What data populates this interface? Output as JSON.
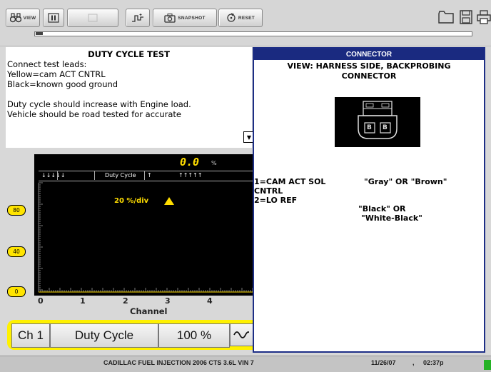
{
  "toolbar": {
    "view_label": "VIEW",
    "snapshot_label": "SNAPSHOT",
    "reset_label": "RESET"
  },
  "test_panel": {
    "title": "DUTY CYCLE TEST",
    "lines": [
      "Connect test leads:",
      "Yellow=cam ACT CNTRL",
      "Black=known good ground",
      "",
      "Duty cycle should increase with Engine load.",
      "Vehicle should be road tested for accurate"
    ]
  },
  "graph": {
    "readout": "0.0",
    "readout_unit": "%",
    "header_left_arrows": "↓↓↓↓↓",
    "header_label": "Duty Cycle",
    "header_mid_arrow": "↑",
    "header_right_arrows": "↑↑↑↑↑",
    "scale_label": "20 %/div",
    "y_labels": [
      "80",
      "40",
      "0"
    ],
    "x_ticks": [
      "0",
      "1",
      "2",
      "3",
      "4"
    ],
    "x_axis_label": "Channel",
    "marker_color": "#ffdd00",
    "trace_level_percent": 0
  },
  "controls": {
    "channel": "Ch 1",
    "measurement": "Duty Cycle",
    "scale": "100 %",
    "waveform_icon": "sine-wave-icon"
  },
  "connector": {
    "title": "CONNECTOR",
    "subtitle_line1": "VIEW: HARNESS SIDE, BACKPROBING",
    "subtitle_line2": "CONNECTOR",
    "pin_labels": [
      "B",
      "B"
    ],
    "pins": [
      {
        "desc_line1": "1=CAM ACT SOL",
        "desc_line2": "CNTRL",
        "wire_line1": "\"Gray\" OR \"Brown\"",
        "wire_line2": ""
      },
      {
        "desc_line1": "2=LO REF",
        "desc_line2": "",
        "wire_line1": "\"Black\" OR",
        "wire_line2": "\"White-Black\""
      }
    ],
    "header_color": "#1a2a80"
  },
  "status": {
    "vehicle": "CADILLAC FUEL INJECTION 2006 CTS 3.6L VIN 7",
    "date": "11/26/07",
    "time": "02:37p",
    "indicator_color": "#24b224"
  }
}
